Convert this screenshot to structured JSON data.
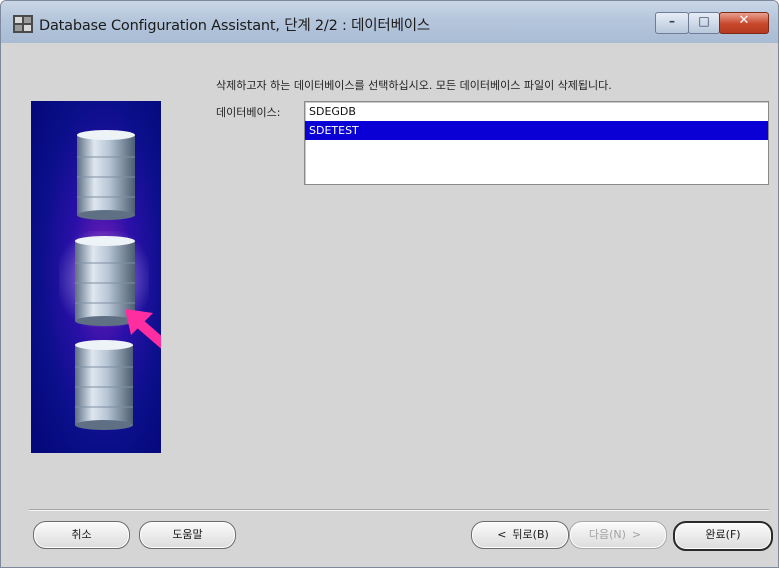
{
  "window": {
    "title": "Database Configuration Assistant, 단계 2/2 : 데이터베이스",
    "minimize_glyph": "–",
    "maximize_glyph": "□",
    "close_glyph": "✕"
  },
  "content": {
    "instruction": "삭제하고자 하는 데이터베이스를 선택하십시오. 모든 데이터베이스 파일이 삭제됩니다.",
    "database_label": "데이터베이스:",
    "databases": [
      {
        "name": "SDEGDB",
        "selected": false
      },
      {
        "name": "SDETEST",
        "selected": true
      }
    ]
  },
  "buttons": {
    "cancel": "취소",
    "help": "도움말",
    "back_arrow": "<",
    "back": "뒤로(B)",
    "next": "다음(N)",
    "next_arrow": ">",
    "finish": "완료(F)"
  },
  "colors": {
    "selection": "#0a00d6",
    "art_background": "#0a0f8a",
    "arrow": "#ff2ea0",
    "dialog_background": "#d5d5d5"
  },
  "icons": {
    "app": "database-app-icon",
    "art": "database-cylinders-illustration",
    "pointer": "magenta-arrow-icon"
  }
}
